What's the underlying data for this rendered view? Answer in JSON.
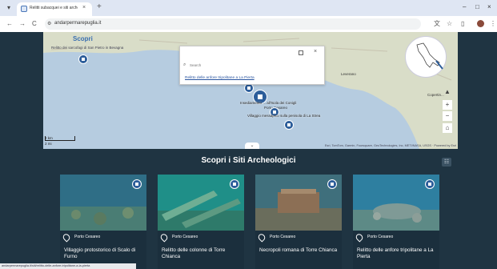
{
  "browser": {
    "tab_title": "Relitti subacquei e siti archeologici",
    "tab_close": "×",
    "new_tab": "+",
    "url": "andarpermarepuglia.it",
    "nav": {
      "back": "←",
      "forward": "→",
      "reload": "C"
    },
    "window": {
      "minimize": "–",
      "maximize": "□",
      "close": "×"
    },
    "icons": [
      "translate-icon",
      "star-icon",
      "extensions-icon",
      "profile-icon",
      "menu-icon"
    ]
  },
  "map": {
    "title": "Scopri",
    "subtitle": "Relitto dei sarcofagi di San Pietro in Bevagna",
    "places": {
      "leverano": "Leverano",
      "copertino": "Copertin...",
      "porto_cesareo": "Porto Cesareo"
    },
    "pin_labels": {
      "insediamento": "Insediamento ... all'Isola dei Conigli",
      "villaggio": "Villaggio messapico sulla penisola di La Strea"
    },
    "search": {
      "placeholder": "Search",
      "result": "Relitto delle anfore tripolitane a La Pierta",
      "close": "×"
    },
    "scale": {
      "km": "2 km",
      "mi": "2 mi"
    },
    "attribution": "Esri, TomTom, Garmin, Foursquare, GeoTechnologies, Inc, METI/NASA, USGS · Powered by Esri",
    "controls": {
      "zoom_in": "+",
      "zoom_out": "−",
      "home": "⌂",
      "compass": "▲"
    },
    "chevron": "⌄"
  },
  "section": {
    "title": "Scopri i Siti Archeologici",
    "grid_icon": "☷"
  },
  "cards": [
    {
      "location": "Porto Cesareo",
      "name": "Villaggio protostorico di Scalo di Furno"
    },
    {
      "location": "Porto Cesareo",
      "name": "Relitto delle colonne di Torre Chianca"
    },
    {
      "location": "Porto Cesareo",
      "name": "Necropoli romana di Torre Chianca"
    },
    {
      "location": "Porto Cesareo",
      "name": "Relitto delle anfore tripolitane a La Pierta"
    }
  ],
  "status_bar": "andarpermarepuglia.it/siti/relitto-delle-anfore-tripolitane-a-la-pierta"
}
